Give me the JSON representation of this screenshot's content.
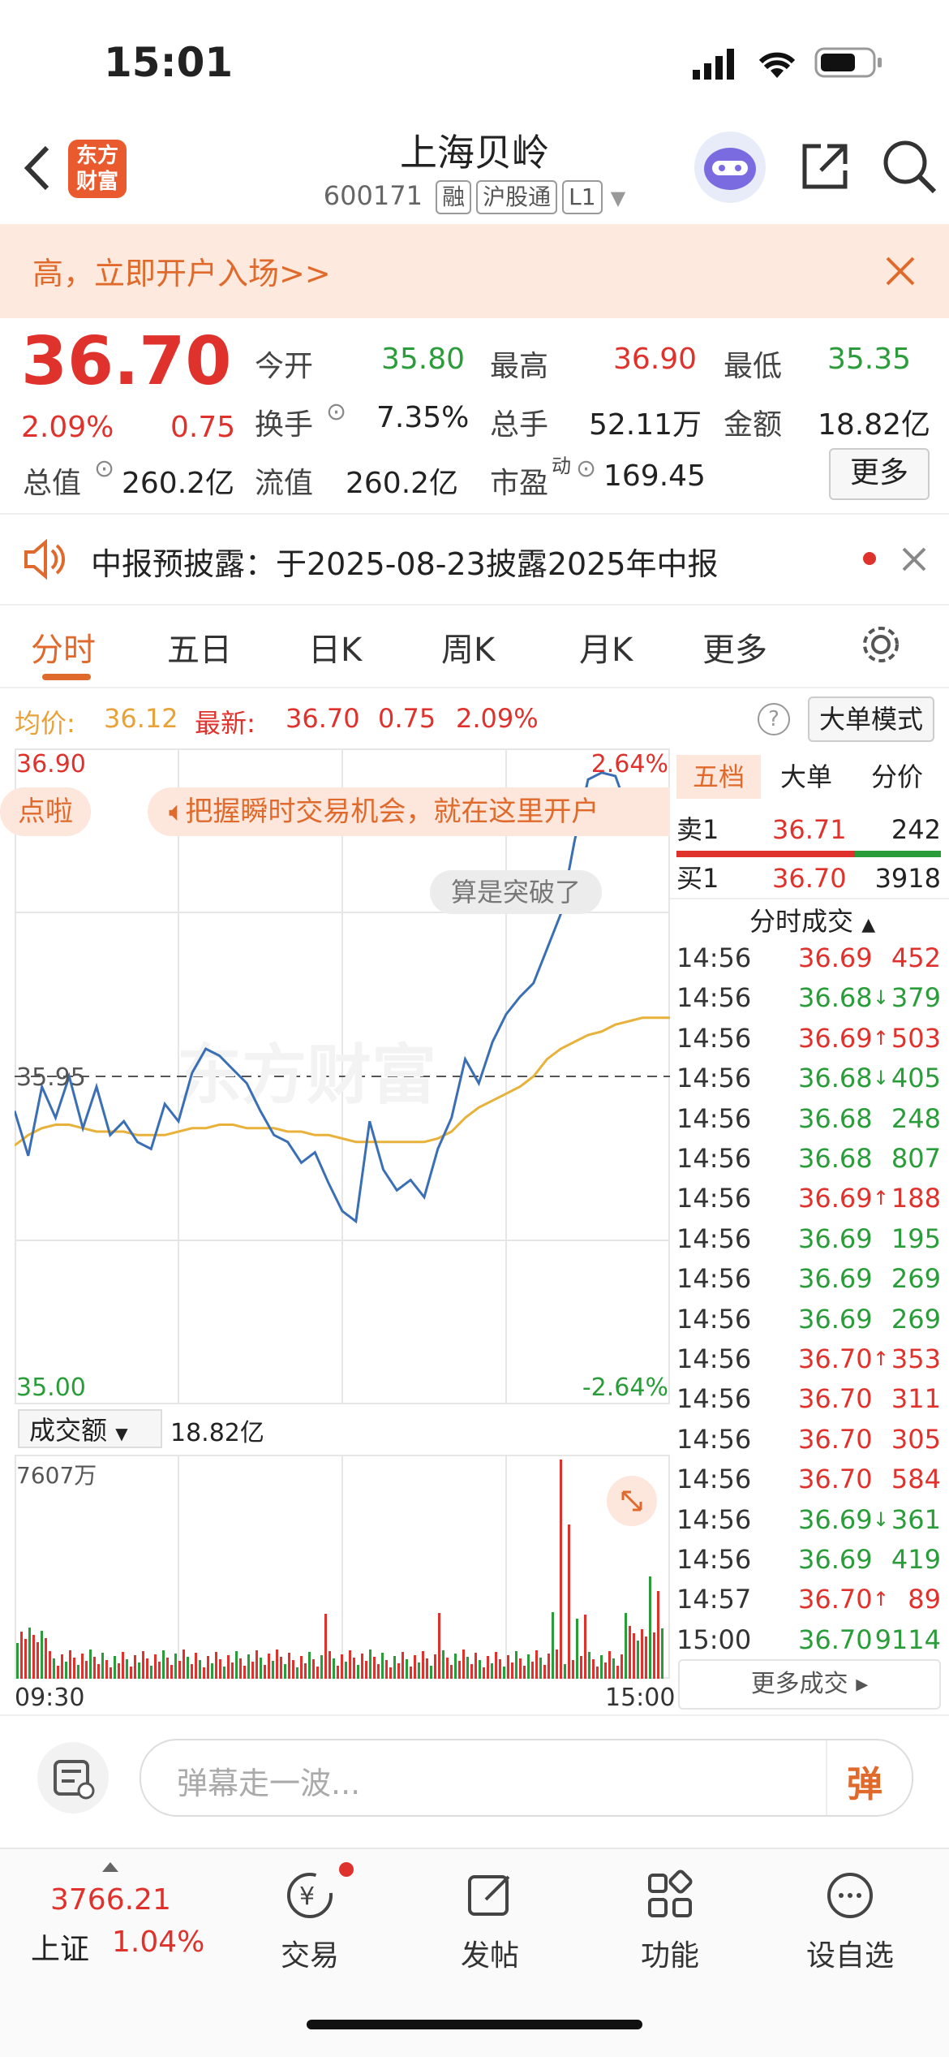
{
  "status": {
    "time": "15:01"
  },
  "header": {
    "back": "‹",
    "logo": "东方财富",
    "title": "上海贝岭",
    "code": "600171",
    "tags": [
      "融",
      "沪股通",
      "L1"
    ]
  },
  "banner": {
    "text": "高，立即开户入场>>"
  },
  "quote": {
    "price": "36.70",
    "pct": "2.09%",
    "chg": "0.75",
    "open_label": "今开",
    "open": "35.80",
    "high_label": "最高",
    "high": "36.90",
    "low_label": "最低",
    "low": "35.35",
    "turnover_label": "换手",
    "turnover": "7.35%",
    "volume_label": "总手",
    "volume": "52.11万",
    "amount_label": "金额",
    "amount": "18.82亿",
    "mktcap_label": "总值",
    "mktcap": "260.2亿",
    "float_label": "流值",
    "float": "260.2亿",
    "pe_label": "市盈",
    "pe_sup": "动",
    "pe": "169.45",
    "more": "更多"
  },
  "notice": {
    "text": "中报预披露：于2025-08-23披露2025年中报"
  },
  "tabs": [
    "分时",
    "五日",
    "日K",
    "周K",
    "月K",
    "更多"
  ],
  "info": {
    "avg_label": "均价:",
    "avg": "36.12",
    "last_label": "最新:",
    "last": "36.70",
    "chg": "0.75",
    "pct": "2.09%",
    "mode": "大单模式"
  },
  "chart": {
    "ymax": "36.90",
    "ymin": "35.00",
    "pmax": "2.64%",
    "pmin": "-2.64%",
    "base": "35.95",
    "promo1": "点啦",
    "promo2": "把握瞬时交易机会，就在这里开户",
    "bubble": "算是突破了",
    "watermark": "东方财富",
    "vol_label": "成交额",
    "vol_total": "18.82亿",
    "vol_max": "7607万",
    "time_start": "09:30",
    "time_end": "15:00"
  },
  "chart_data": {
    "type": "line",
    "title": "",
    "series": [
      {
        "name": "最新",
        "values": [
          35.85,
          35.72,
          35.92,
          35.83,
          35.95,
          35.8,
          35.92,
          35.78,
          35.82,
          35.76,
          35.74,
          35.87,
          35.82,
          35.96,
          36.03,
          36.01,
          35.97,
          35.93,
          35.85,
          35.78,
          35.76,
          35.7,
          35.73,
          35.64,
          35.56,
          35.53,
          35.82,
          35.68,
          35.62,
          35.65,
          35.6,
          35.74,
          35.83,
          36.0,
          35.93,
          36.05,
          36.13,
          36.18,
          36.22,
          36.32,
          36.42,
          36.63,
          36.81,
          36.83,
          36.82,
          36.71,
          36.68,
          36.75,
          36.78
        ]
      },
      {
        "name": "均价",
        "values": [
          35.75,
          35.78,
          35.8,
          35.81,
          35.81,
          35.8,
          35.79,
          35.79,
          35.79,
          35.78,
          35.78,
          35.78,
          35.79,
          35.8,
          35.8,
          35.81,
          35.81,
          35.8,
          35.8,
          35.8,
          35.79,
          35.79,
          35.78,
          35.78,
          35.77,
          35.76,
          35.76,
          35.76,
          35.76,
          35.76,
          35.76,
          35.77,
          35.79,
          35.83,
          35.86,
          35.88,
          35.9,
          35.92,
          35.95,
          36.0,
          36.03,
          36.05,
          36.07,
          36.08,
          36.1,
          36.11,
          36.12,
          36.12,
          36.12
        ]
      }
    ],
    "ylim": [
      35.0,
      36.9
    ],
    "xlabel": "",
    "ylabel": ""
  },
  "side": {
    "tabs": [
      "五档",
      "大单",
      "分价"
    ],
    "sell1_label": "卖1",
    "sell1_price": "36.71",
    "sell1_vol": "242",
    "buy1_label": "买1",
    "buy1_price": "36.70",
    "buy1_vol": "3918",
    "trades_title": "分时成交",
    "trades": [
      {
        "t": "14:56",
        "p": "36.69",
        "d": "",
        "v": "452",
        "c": "red"
      },
      {
        "t": "14:56",
        "p": "36.68",
        "d": "↓",
        "v": "379",
        "c": "green"
      },
      {
        "t": "14:56",
        "p": "36.69",
        "d": "↑",
        "v": "503",
        "c": "red"
      },
      {
        "t": "14:56",
        "p": "36.68",
        "d": "↓",
        "v": "405",
        "c": "green"
      },
      {
        "t": "14:56",
        "p": "36.68",
        "d": "",
        "v": "248",
        "c": "green"
      },
      {
        "t": "14:56",
        "p": "36.68",
        "d": "",
        "v": "807",
        "c": "green"
      },
      {
        "t": "14:56",
        "p": "36.69",
        "d": "↑",
        "v": "188",
        "c": "red"
      },
      {
        "t": "14:56",
        "p": "36.69",
        "d": "",
        "v": "195",
        "c": "green"
      },
      {
        "t": "14:56",
        "p": "36.69",
        "d": "",
        "v": "269",
        "c": "green"
      },
      {
        "t": "14:56",
        "p": "36.69",
        "d": "",
        "v": "269",
        "c": "green"
      },
      {
        "t": "14:56",
        "p": "36.70",
        "d": "↑",
        "v": "353",
        "c": "red"
      },
      {
        "t": "14:56",
        "p": "36.70",
        "d": "",
        "v": "311",
        "c": "red"
      },
      {
        "t": "14:56",
        "p": "36.70",
        "d": "",
        "v": "305",
        "c": "red"
      },
      {
        "t": "14:56",
        "p": "36.70",
        "d": "",
        "v": "584",
        "c": "red"
      },
      {
        "t": "14:56",
        "p": "36.69",
        "d": "↓",
        "v": "361",
        "c": "green"
      },
      {
        "t": "14:56",
        "p": "36.69",
        "d": "",
        "v": "419",
        "c": "green"
      },
      {
        "t": "14:57",
        "p": "36.70",
        "d": "↑",
        "v": "89",
        "c": "red"
      },
      {
        "t": "15:00",
        "p": "36.70",
        "d": "",
        "v": "9114",
        "c": "green"
      }
    ],
    "more_trades": "更多成交 ▸"
  },
  "danmu": {
    "placeholder": "弹幕走一波...",
    "btn": "弹"
  },
  "tabbar": {
    "index_value": "3766.21",
    "index_name": "上证",
    "index_pct": "1.04%",
    "items": [
      "交易",
      "发帖",
      "功能",
      "设自选"
    ]
  },
  "colors": {
    "up": "#e0322d",
    "down": "#2a9d3a",
    "accent": "#e06a2c",
    "line": "#3a6fb5",
    "avg": "#e8b23a"
  }
}
